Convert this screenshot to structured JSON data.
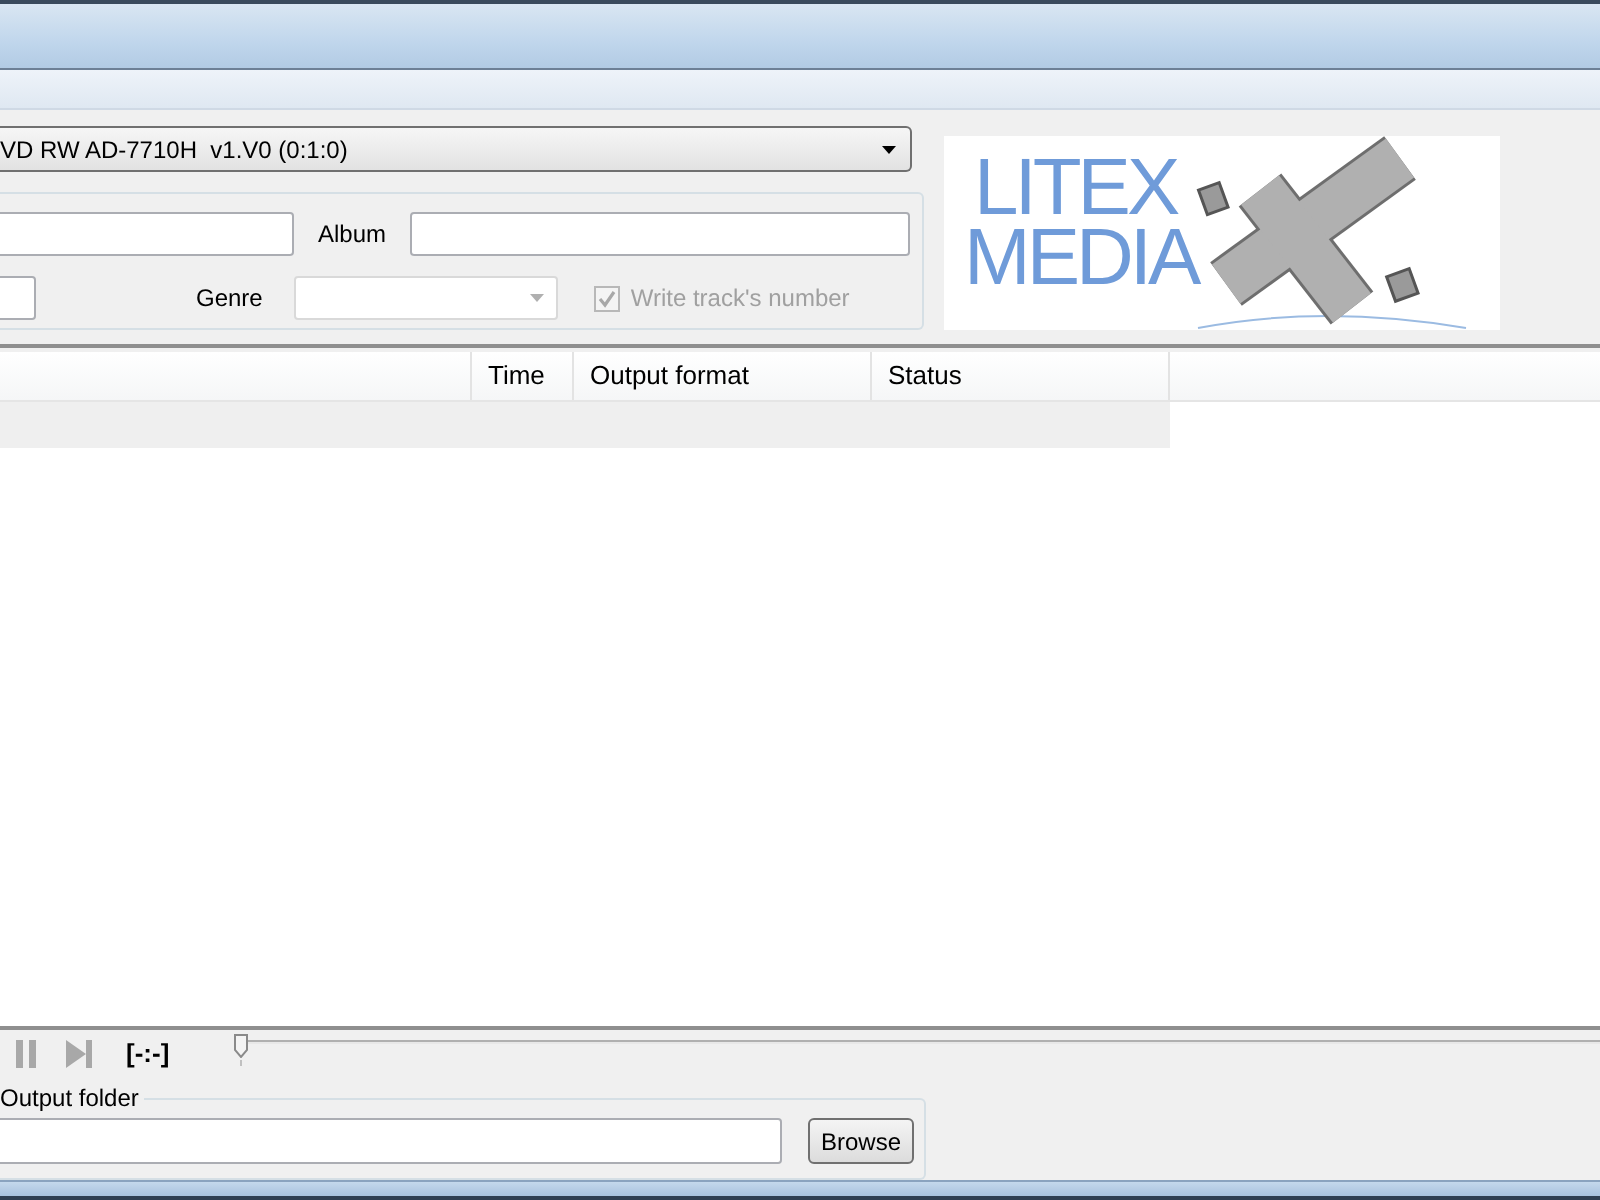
{
  "drive_selector": {
    "value": "VD RW AD-7710H  v1.V0 (0:1:0)"
  },
  "tags": {
    "album": {
      "label": "Album"
    },
    "genre": {
      "label": "Genre",
      "disabled": true
    },
    "write_track_number": {
      "label": "Write track's number",
      "checked": true,
      "disabled": true
    }
  },
  "logo": {
    "lines": [
      "LITEX",
      "MEDIA"
    ]
  },
  "table": {
    "columns": [
      {
        "label": "Time"
      },
      {
        "label": "Output format"
      },
      {
        "label": "Status"
      }
    ]
  },
  "player": {
    "controls_disabled": true,
    "timecode": "[-:-]",
    "seek": {
      "level": 0
    }
  },
  "output_folder": {
    "label": "Output folder",
    "browse_button": "Browse"
  }
}
